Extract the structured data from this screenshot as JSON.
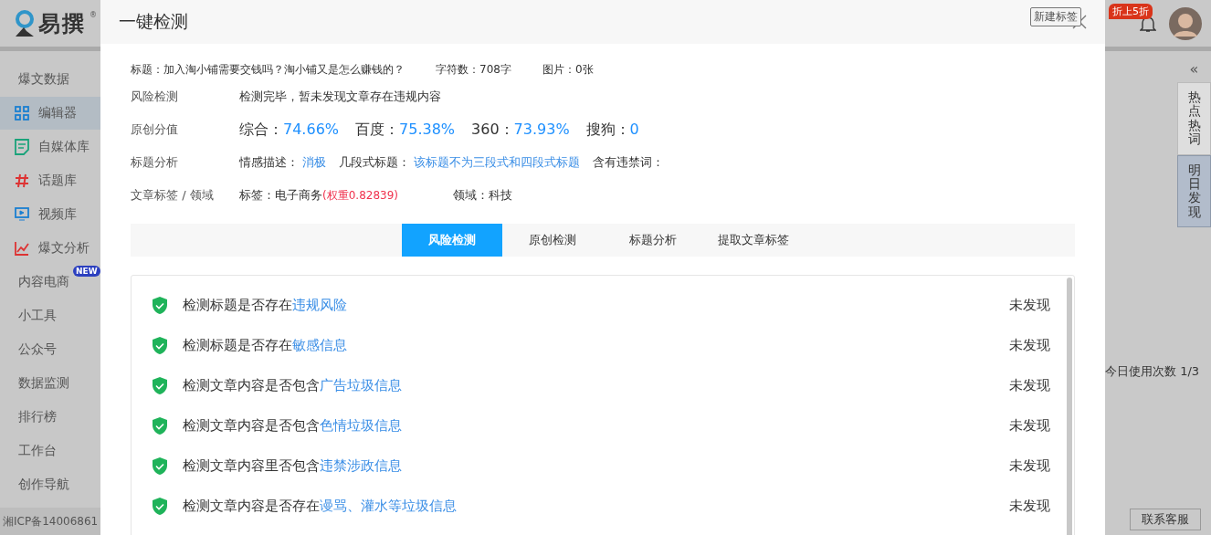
{
  "app": {
    "logo": "易撰",
    "logo_mark": "®",
    "sidebar": [
      {
        "label": "爆文数据",
        "selected": false
      },
      {
        "label": "编辑器",
        "selected": true,
        "kind": "icon"
      },
      {
        "label": "自媒体库",
        "selected": false,
        "kind": "icon"
      },
      {
        "label": "话题库",
        "selected": false,
        "kind": "icon"
      },
      {
        "label": "视频库",
        "selected": false,
        "kind": "icon"
      },
      {
        "label": "爆文分析",
        "selected": false,
        "kind": "icon"
      },
      {
        "label": "内容电商",
        "selected": false,
        "badge": "NEW"
      },
      {
        "label": "小工具",
        "selected": false
      },
      {
        "label": "公众号",
        "selected": false
      },
      {
        "label": "数据监测",
        "selected": false
      },
      {
        "label": "排行榜",
        "selected": false
      },
      {
        "label": "工作台",
        "selected": false
      },
      {
        "label": "创作导航",
        "selected": false
      }
    ],
    "icp": "湘ICP备14006861",
    "promo_badge": "折上5折",
    "side_panel": {
      "collapse": "«",
      "tabs": [
        {
          "label": "热点热词",
          "selected": false
        },
        {
          "label": "明日发现",
          "selected": true
        }
      ]
    },
    "usage": "今日使用次数 1/3",
    "support_button": "联系客服"
  },
  "modal": {
    "title": "一键检测",
    "tooltip": "新建标签",
    "summary": {
      "title": "标题：加入淘小铺需要交钱吗？淘小铺又是怎么赚钱的？",
      "chars": "字符数：708字",
      "images": "图片：0张"
    },
    "risk": {
      "label": "风险检测",
      "text": "检测完毕，暂未发现文章存在违规内容"
    },
    "originality": {
      "label": "原创分值",
      "scores": [
        {
          "name": "综合：",
          "value": "74.66%"
        },
        {
          "name": "百度：",
          "value": "75.38%"
        },
        {
          "name": "360：",
          "value": "73.93%"
        },
        {
          "name": "搜狗：",
          "value": "0"
        }
      ]
    },
    "title_analysis": {
      "label": "标题分析",
      "items": [
        {
          "name": "情感描述：",
          "value": "消极"
        },
        {
          "name": "几段式标题：",
          "value": "该标题不为三段式和四段式标题"
        },
        {
          "name": "含有违禁词："
        }
      ]
    },
    "tags": {
      "label": "文章标签 / 领域",
      "tag": "标签：电子商务",
      "weight": "(权重0.82839)",
      "domain": "领域：科技"
    },
    "tabs": [
      {
        "label": "风险检测",
        "selected": true
      },
      {
        "label": "原创检测",
        "selected": false
      },
      {
        "label": "标题分析",
        "selected": false
      },
      {
        "label": "提取文章标签",
        "selected": false
      }
    ],
    "checks": [
      {
        "text": "检测标题是否存在",
        "highlight": "违规风险",
        "result": "未发现"
      },
      {
        "text": "检测标题是否存在",
        "highlight": "敏感信息",
        "result": "未发现"
      },
      {
        "text": "检测文章内容是否包含",
        "highlight": "广告垃圾信息",
        "result": "未发现"
      },
      {
        "text": "检测文章内容是否包含",
        "highlight": "色情垃圾信息",
        "result": "未发现"
      },
      {
        "text": "检测文章内容里否包含",
        "highlight": "违禁涉政信息",
        "result": "未发现"
      },
      {
        "text": "检测文章内容是否存在",
        "highlight": "谩骂、灌水等垃圾信息",
        "result": "未发现"
      }
    ]
  }
}
